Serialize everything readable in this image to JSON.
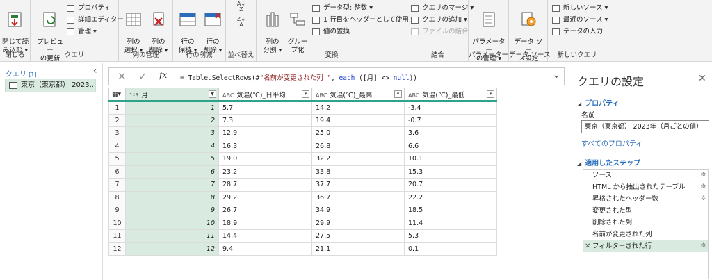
{
  "ribbon": {
    "close": {
      "btn": "閉じて読\nみ込む",
      "label": "閉じる"
    },
    "query": {
      "preview": "プレビュー\nの更新",
      "properties": "プロパティ",
      "advanced_editor": "詳細エディター",
      "manage": "管理",
      "label": "クエリ"
    },
    "columns": {
      "select": "列の\n選択",
      "remove": "列の\n削除",
      "label": "列の管理"
    },
    "rows": {
      "keep": "行の\n保持",
      "remove": "行の\n削除",
      "label": "行の削減"
    },
    "sort": {
      "label": "並べ替え"
    },
    "transform": {
      "split": "列の\n分割",
      "group": "グルー\nプ化",
      "datatype": "データ型: 整数",
      "first_row_header": "1 行目をヘッダーとして使用",
      "replace": "値の置換",
      "label": "変換"
    },
    "combine": {
      "merge": "クエリのマージ",
      "append": "クエリの追加",
      "combine_files": "ファイルの結合",
      "label": "結合"
    },
    "parameters": {
      "manage": "パラメーター\nの管理",
      "label": "パラメーター"
    },
    "datasource": {
      "settings": "データ ソー\nス設定",
      "label": "データ ソース"
    },
    "newquery": {
      "new_source": "新しいソース",
      "recent": "最近のソース",
      "enter_data": "データの入力",
      "label": "新しいクエリ"
    }
  },
  "queries": {
    "header": "クエリ",
    "count": "[1]",
    "item": "東京（東京都） 2023..."
  },
  "formula": {
    "prefix": "= Table.SelectRows(#",
    "string": "\"名前が変更された列 \"",
    "mid": ", ",
    "kw_each": "each",
    "tail": " ([月] <> ",
    "kw_null": "null",
    "end": "))"
  },
  "table": {
    "columns": [
      {
        "type": "1²3",
        "name": "月"
      },
      {
        "type": "ABC",
        "name": "気温(℃)_日平均"
      },
      {
        "type": "ABC",
        "name": "気温(℃)_最高"
      },
      {
        "type": "ABC",
        "name": "気温(℃)_最低"
      }
    ],
    "rows": [
      [
        "1",
        "5.7",
        "14.2",
        "-3.4"
      ],
      [
        "2",
        "7.3",
        "19.4",
        "-0.7"
      ],
      [
        "3",
        "12.9",
        "25.0",
        "3.6"
      ],
      [
        "4",
        "16.3",
        "26.8",
        "6.6"
      ],
      [
        "5",
        "19.0",
        "32.2",
        "10.1"
      ],
      [
        "6",
        "23.2",
        "33.8",
        "15.3"
      ],
      [
        "7",
        "28.7",
        "37.7",
        "20.7"
      ],
      [
        "8",
        "29.2",
        "36.7",
        "22.2"
      ],
      [
        "9",
        "26.7",
        "34.9",
        "18.5"
      ],
      [
        "10",
        "18.9",
        "29.9",
        "11.4"
      ],
      [
        "11",
        "14.4",
        "27.5",
        "5.3"
      ],
      [
        "12",
        "9.4",
        "21.1",
        "0.1"
      ]
    ]
  },
  "settings": {
    "title": "クエリの設定",
    "properties_header": "プロパティ",
    "name_label": "名前",
    "name_value": "東京（東京都） 2023年（月ごとの値）",
    "all_properties": "すべてのプロパティ",
    "steps_header": "適用したステップ",
    "steps": [
      "ソース",
      "HTML から抽出されたテーブル",
      "昇格されたヘッダー数",
      "変更された型",
      "削除された列",
      "名前が変更された列",
      "フィルターされた行"
    ]
  },
  "colors": {
    "accent_green": "#2ea38a",
    "selection": "#d9ebe1",
    "link_blue": "#2a6ebb"
  }
}
